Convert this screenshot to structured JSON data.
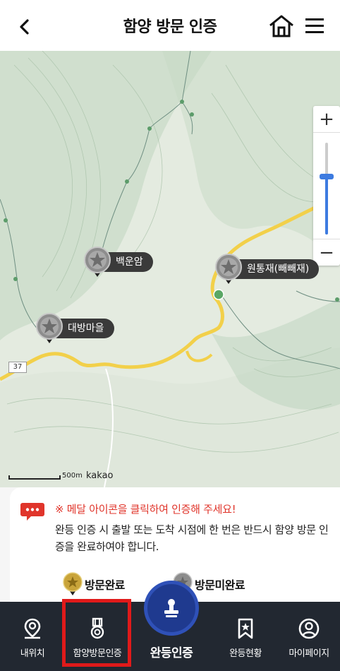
{
  "header": {
    "title": "함양 방문 인증"
  },
  "map": {
    "markers": [
      {
        "label": "백운암"
      },
      {
        "label": "원통재(빼빼재)"
      },
      {
        "label": "대방마을"
      }
    ],
    "route_number": "37",
    "scale_label": "500m",
    "provider": "kakao",
    "zoom_in": "+",
    "zoom_out": "−"
  },
  "info": {
    "notice_title": "※ 메달 아이콘을 클릭하여 인증해 주세요!",
    "notice_body": "완등 인증 시 출발 또는 도착 시점에 한 번은 반드시 함양 방문 인증을 완료하여야 합니다.",
    "legend_done": "방문완료",
    "legend_not_done": "방문미완료"
  },
  "nav": {
    "items": [
      {
        "label": "내위치"
      },
      {
        "label": "함양방문인증"
      },
      {
        "label": "완등인증"
      },
      {
        "label": "완등현황"
      },
      {
        "label": "마이페이지"
      }
    ]
  },
  "colors": {
    "accent": "#2f51b8",
    "nav_bg": "#222831",
    "notice_red": "#e0352b",
    "selected_outline": "#e01a1a",
    "road": "#f2d04a"
  }
}
